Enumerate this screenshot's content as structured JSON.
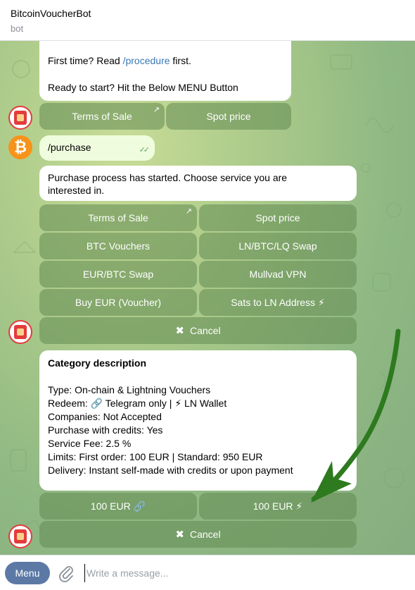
{
  "header": {
    "title": "BitcoinVoucherBot",
    "subtitle": "bot"
  },
  "colors": {
    "chat_bg": "#a9c98a",
    "keyboard_button": "#628b52",
    "menu_button": "#5c79a6",
    "link": "#3a79b5",
    "arrow": "#2e7a1f"
  },
  "messages": {
    "intro": {
      "line1_prefix": "First time? Read ",
      "line1_link": "/procedure",
      "line1_suffix": " first.",
      "line2": "Ready to start? Hit the Below MENU Button"
    },
    "intro_keyboard": {
      "terms": "Terms of Sale",
      "spot": "Spot price"
    },
    "user_command": "/purchase",
    "purchase": {
      "text_line1": "Purchase process has started. Choose service you are",
      "text_line2": "interested in.",
      "buttons": {
        "terms": "Terms of Sale",
        "spot": "Spot price",
        "btc_vouchers": "BTC Vouchers",
        "ln_swap": "LN/BTC/LQ Swap",
        "eur_btc_swap": "EUR/BTC Swap",
        "mullvad": "Mullvad VPN",
        "buy_eur": "Buy EUR (Voucher)",
        "sats_ln": "Sats to LN Address ⚡",
        "cancel": "Cancel"
      }
    },
    "category": {
      "heading": "Category description",
      "type": "Type: On-chain & Lightning Vouchers",
      "redeem": "Redeem: 🔗 Telegram only | ⚡ LN Wallet",
      "companies": "Companies: Not Accepted",
      "credits": "Purchase with credits: Yes",
      "fee": "Service Fee: 2.5 %",
      "limits": "Limits: First order: 100 EUR | Standard: 950 EUR",
      "delivery": "Delivery: Instant self-made with credits or upon payment",
      "buttons": {
        "eur_link": "100 EUR 🔗",
        "eur_ln": "100 EUR ⚡",
        "cancel": "Cancel"
      }
    }
  },
  "composer": {
    "menu_label": "Menu",
    "placeholder": "Write a message..."
  },
  "icons": [
    "attach-icon",
    "double-check-icon",
    "external-link-icon",
    "close-icon",
    "bitcoin-icon",
    "bot-avatar-icon"
  ]
}
